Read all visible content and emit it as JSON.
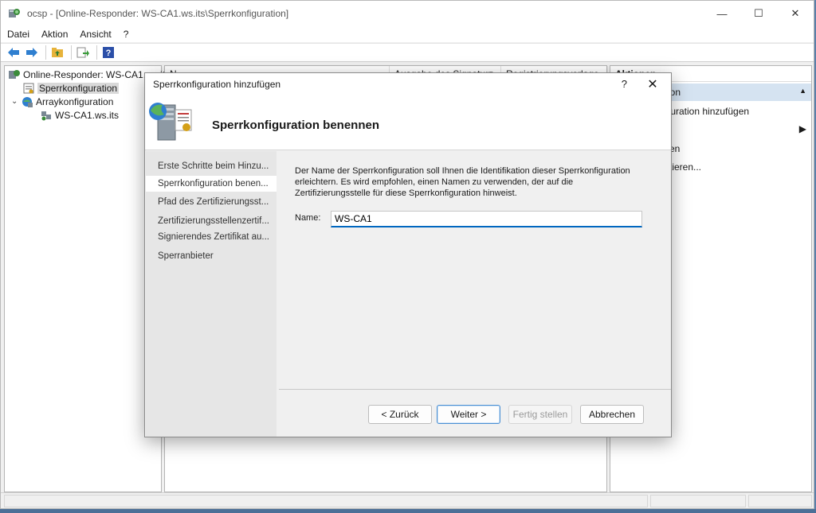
{
  "window": {
    "title": "ocsp - [Online-Responder: WS-CA1.ws.its\\Sperrkonfiguration]",
    "minimize": "—",
    "maximize": "☐",
    "close": "✕"
  },
  "menu": {
    "items": [
      "Datei",
      "Aktion",
      "Ansicht",
      "?"
    ]
  },
  "tree": {
    "root": "Online-Responder: WS-CA1.ws.its",
    "items": [
      {
        "label": "Sperrkonfiguration"
      },
      {
        "label": "Arraykonfiguration"
      },
      {
        "label": "WS-CA1.ws.its"
      }
    ]
  },
  "list": {
    "columns": [
      "N",
      "Ausgabe des Signaturz...",
      "Registrierungsvorlage"
    ]
  },
  "actions": {
    "header": "Aktionen",
    "section": "ation",
    "items": [
      "iguration hinzufügen",
      "ren",
      "rtieren..."
    ]
  },
  "dialog": {
    "title": "Sperrkonfiguration hinzufügen",
    "help": "?",
    "close": "✕",
    "heading": "Sperrkonfiguration benennen",
    "steps": [
      "Erste Schritte beim Hinzu...",
      "Sperrkonfiguration benen...",
      "Pfad des Zertifizierungsst...",
      "Zertifizierungsstellenzertif...",
      "Signierendes Zertifikat au...",
      "Sperranbieter"
    ],
    "description": "Der Name der Sperrkonfiguration soll Ihnen die Identifikation dieser Sperrkonfiguration erleichtern. Es wird empfohlen, einen Namen zu verwenden, der auf die Zertifizierungsstelle für diese Sperrkonfiguration hinweist.",
    "name_label": "Name:",
    "name_value": "WS-CA1",
    "buttons": {
      "back": "< Zurück",
      "next": "Weiter >",
      "finish": "Fertig stellen",
      "cancel": "Abbrechen"
    }
  },
  "colors": {
    "accent": "#0067c0",
    "selection": "#d9d9d9",
    "action_section": "#d5e3f1"
  }
}
